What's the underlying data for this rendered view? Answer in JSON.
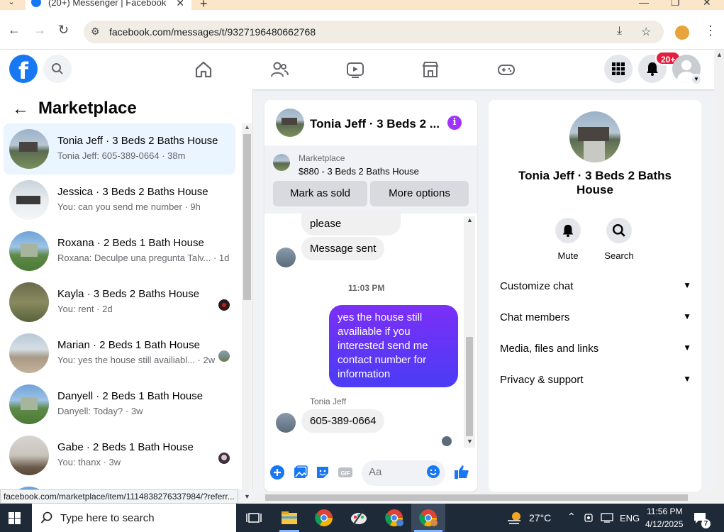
{
  "browser": {
    "tab_title": "(20+) Messenger | Facebook",
    "url": "facebook.com/messages/t/9327196480662768",
    "status_url": "facebook.com/marketplace/item/1114838276337984/?referr..."
  },
  "header": {
    "logo_letter": "f",
    "notif_badge": "20+"
  },
  "left": {
    "title": "Marketplace",
    "conversations": [
      {
        "name": "Tonia Jeff · 3 Beds 2 Baths House",
        "snippet": "Tonia Jeff: 605-389-0664 · 38m"
      },
      {
        "name": "Jessica · 3 Beds 2 Baths House",
        "snippet": "You: can you send me number · 9h"
      },
      {
        "name": "Roxana · 2 Beds 1 Bath House",
        "snippet": "Roxana: Deculpe una pregunta Talv... · 1d"
      },
      {
        "name": "Kayla · 3 Beds 2 Baths House",
        "snippet": "You: rent · 2d"
      },
      {
        "name": "Marian · 2 Beds 1 Bath House",
        "snippet": "You: yes the house still availiabl... · 2w"
      },
      {
        "name": "Danyell · 2 Beds 1 Bath House",
        "snippet": "Danyell: Today? · 3w"
      },
      {
        "name": "Gabe · 2 Beds 1 Bath House",
        "snippet": "You: thanx · 3w"
      }
    ]
  },
  "chat": {
    "title": "Tonia Jeff · 3 Beds 2 ...",
    "marketplace_label": "Marketplace",
    "listing": "$880 - 3 Beds 2 Baths House",
    "mark_sold": "Mark as sold",
    "more_options": "More options",
    "msg_please": "please",
    "msg_sent": "Message sent",
    "time": "11:03 PM",
    "out_msg": "yes the house still availiable if you interested send me contact number for information",
    "sender": "Tonia Jeff",
    "in_msg": "605-389-0664",
    "composer_placeholder": "Aa"
  },
  "info": {
    "name": "Tonia Jeff · 3 Beds 2 Baths House",
    "mute": "Mute",
    "search": "Search",
    "rows": [
      "Customize chat",
      "Chat members",
      "Media, files and links",
      "Privacy & support"
    ]
  },
  "taskbar": {
    "search_placeholder": "Type here to search",
    "temp": "27°C",
    "lang": "ENG",
    "time": "11:56 PM",
    "date": "4/12/2025",
    "notif_count": "7"
  },
  "colors": {
    "fb_blue": "#1877f2",
    "messenger_purple": "#a033ff",
    "active_row": "#ebf5ff",
    "badge_red": "#e41e3f"
  }
}
